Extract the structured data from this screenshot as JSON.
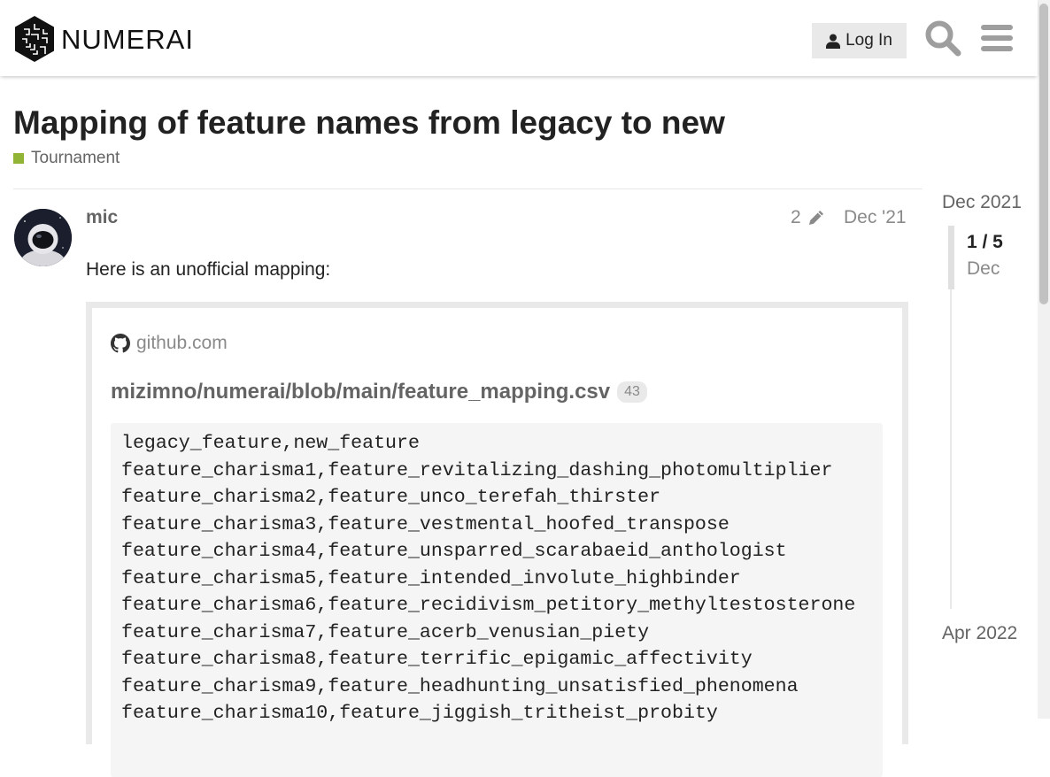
{
  "header": {
    "logo_text": "NUMERAI",
    "login_label": "Log In",
    "icons": [
      "user-icon",
      "search-icon",
      "hamburger-menu-icon"
    ]
  },
  "topic": {
    "title": "Mapping of feature names from legacy to new",
    "category": "Tournament",
    "category_color": "#92b436"
  },
  "post": {
    "username": "mic",
    "edit_count": "2",
    "date": "Dec '21",
    "text": "Here is an unofficial mapping:"
  },
  "onebox": {
    "domain": "github.com",
    "title": "mizimno/numerai/blob/main/feature_mapping.csv",
    "clicks": "43",
    "code_lines": [
      "legacy_feature,new_feature",
      "feature_charisma1,feature_revitalizing_dashing_photomultiplier",
      "feature_charisma2,feature_unco_terefah_thirster",
      "feature_charisma3,feature_vestmental_hoofed_transpose",
      "feature_charisma4,feature_unsparred_scarabaeid_anthologist",
      "feature_charisma5,feature_intended_involute_highbinder",
      "feature_charisma6,feature_recidivism_petitory_methyltestosterone",
      "feature_charisma7,feature_acerb_venusian_piety",
      "feature_charisma8,feature_terrific_epigamic_affectivity",
      "feature_charisma9,feature_headhunting_unsatisfied_phenomena",
      "feature_charisma10,feature_jiggish_tritheist_probity"
    ]
  },
  "timeline": {
    "start": "Dec 2021",
    "position": "1 / 5",
    "current_date": "Dec",
    "end": "Apr 2022"
  }
}
